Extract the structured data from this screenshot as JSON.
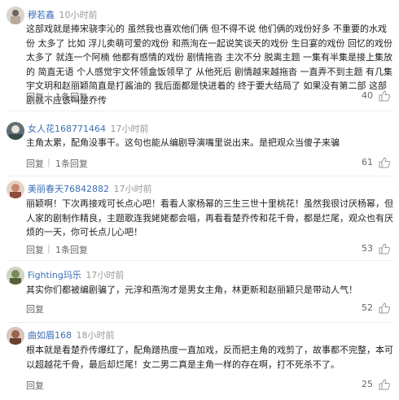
{
  "comments": [
    {
      "user": "穆若鑫",
      "time": "10小时前",
      "text": "这部戏就是捧宋骁李沁的 虽然我也喜欢他们俩 但不得不说 他们俩的戏份好多 不重要的水戏份 太多了 比如 浮儿卖萌可爱的戏份 和燕洵在一起说笑谈天的戏份 生日宴的戏份 回忆的戏份 太多了 就连一个阿楠 他都有感情的戏份 剧情拖沓 主次不分 脱离主题 一集有半集是接上集放的 简直无语 个人感觉宇文怀领盒饭领早了 从他死后 剧情越来越拖沓 一直弄不到主题 有几集 宇文玥和赵丽颖简直是打酱油的 我后面都是快进着的 终于要大结局了 如果没有第二部 这部剧就不应该叫楚乔传",
      "reply": "回复",
      "toggle": "1条回复",
      "likes": "40"
    },
    {
      "user": "女人花168771464",
      "time": "17小时前",
      "text": "主角太累，配角没事干。这句也能从编剧导演嘴里说出来。是把观众当傻子来骗",
      "reply": "回复",
      "toggle": "1条回复",
      "likes": "61"
    },
    {
      "user": "美丽春天76842882",
      "time": "17小时前",
      "text": "丽颖啊！下次再接戏可长点心吧！看看人家杨幂的三生三世十里桃花！虽然我很讨厌杨幂，但人家的剧制作精良，主题歌连我姥姥都会唱，再看看楚乔传和花千骨，都是烂尾，观众也有厌烦的一天，你可长点儿心吧！",
      "reply": "回复",
      "toggle": "1条回复",
      "likes": "53"
    },
    {
      "user": "Fighting玛乐",
      "time": "17小时前",
      "text": "其实你们都被编剧骗了，元淳和燕洵才是男女主角，林更新和赵丽颖只是带动人气！",
      "reply": "回复",
      "toggle": "",
      "likes": "52"
    },
    {
      "user": "曲如眉168",
      "time": "18小时前",
      "text": "根本就是看楚乔传爆红了，配角蹭热度一直加戏，反而把主角的戏剪了，故事都不完整，本可以超越花千骨，最后却烂尾！女二男二真是主角一样的存在啊，打不死杀不了。",
      "reply": "回复",
      "toggle": "",
      "likes": "25"
    }
  ]
}
